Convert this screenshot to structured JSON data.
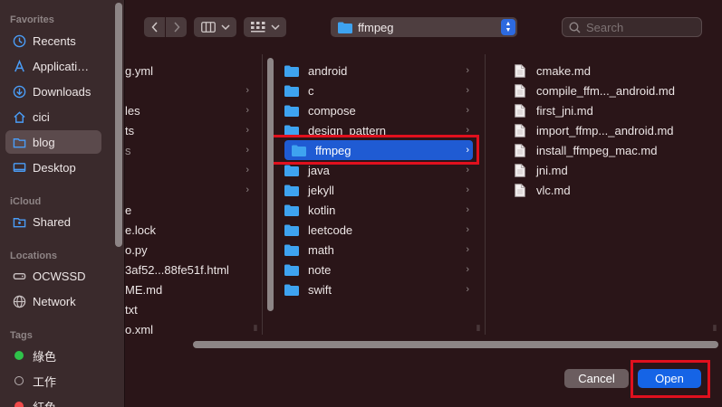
{
  "sidebar": {
    "favorites_header": "Favorites",
    "favorites": [
      {
        "label": "Recents",
        "icon": "clock-icon"
      },
      {
        "label": "Applicati…",
        "icon": "applications-icon"
      },
      {
        "label": "Downloads",
        "icon": "download-icon"
      },
      {
        "label": "cici",
        "icon": "home-icon"
      },
      {
        "label": "blog",
        "icon": "folder-icon",
        "selected": true
      },
      {
        "label": "Desktop",
        "icon": "desktop-icon"
      }
    ],
    "icloud_header": "iCloud",
    "icloud": [
      {
        "label": "Shared",
        "icon": "shared-folder-icon"
      }
    ],
    "locations_header": "Locations",
    "locations": [
      {
        "label": "OCWSSD",
        "icon": "disk-icon"
      },
      {
        "label": "Network",
        "icon": "network-icon"
      }
    ],
    "tags_header": "Tags",
    "tags": [
      {
        "label": "綠色",
        "color": "#2fc24a"
      },
      {
        "label": "工作",
        "color": "hollow"
      },
      {
        "label": "紅色",
        "color": "#f04a4a"
      }
    ]
  },
  "toolbar": {
    "back_icon": "chevron-left-icon",
    "forward_icon": "chevron-right-icon",
    "view_icon": "column-view-icon",
    "group_icon": "grid-group-icon",
    "path_label": "ffmpeg",
    "search_placeholder": "Search"
  },
  "columns": {
    "col1": [
      {
        "label": "g.yml",
        "chevron": false
      },
      {
        "label": "",
        "chevron": true
      },
      {
        "label": "les",
        "chevron": true
      },
      {
        "label": "ts",
        "chevron": true
      },
      {
        "label": "s",
        "chevron": true,
        "dimmed": true
      },
      {
        "label": "",
        "chevron": true
      },
      {
        "label": "",
        "chevron": true
      },
      {
        "label": "e",
        "chevron": false
      },
      {
        "label": "e.lock",
        "chevron": false
      },
      {
        "label": "o.py",
        "chevron": false
      },
      {
        "label": "3af52...88fe51f.html",
        "chevron": false
      },
      {
        "label": "ME.md",
        "chevron": false
      },
      {
        "label": "txt",
        "chevron": false
      },
      {
        "label": "o.xml",
        "chevron": false
      }
    ],
    "col2": [
      {
        "label": "android"
      },
      {
        "label": "c"
      },
      {
        "label": "compose"
      },
      {
        "label": "design_pattern"
      },
      {
        "label": "ffmpeg",
        "selected": true
      },
      {
        "label": "java"
      },
      {
        "label": "jekyll"
      },
      {
        "label": "kotlin"
      },
      {
        "label": "leetcode"
      },
      {
        "label": "math"
      },
      {
        "label": "note"
      },
      {
        "label": "swift"
      }
    ],
    "col3": [
      {
        "label": "cmake.md"
      },
      {
        "label": "compile_ffm..._android.md"
      },
      {
        "label": "first_jni.md"
      },
      {
        "label": "import_ffmp..._android.md"
      },
      {
        "label": "install_ffmpeg_mac.md"
      },
      {
        "label": "jni.md"
      },
      {
        "label": "vlc.md"
      }
    ]
  },
  "footer": {
    "cancel_label": "Cancel",
    "open_label": "Open"
  },
  "colors": {
    "accent": "#1564e6",
    "selection": "#1f5bd3",
    "folder": "#3ea3f0",
    "highlight": "#e0101e"
  }
}
